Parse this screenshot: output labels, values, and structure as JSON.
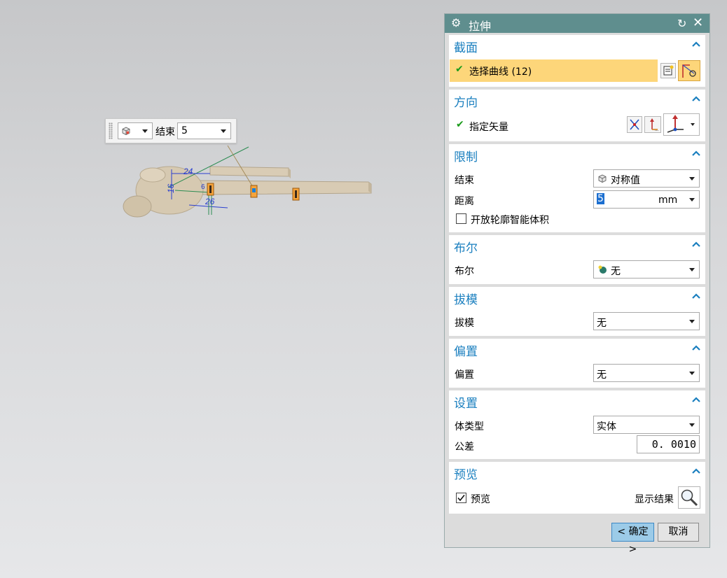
{
  "toolbar": {
    "limit_label": "结束",
    "limit_value": "5"
  },
  "sketch": {
    "dim_24": "24",
    "dim_16": "16",
    "dim_6": "6",
    "dim_26": "26"
  },
  "dialog": {
    "title": "拉伸",
    "sections": {
      "section": {
        "header": "截面",
        "select_curve": "选择曲线 (12)"
      },
      "direction": {
        "header": "方向",
        "specify_vector": "指定矢量"
      },
      "limits": {
        "header": "限制",
        "end_label": "结束",
        "end_value": "对称值",
        "distance_label": "距离",
        "distance_value": "5",
        "distance_unit": "mm",
        "open_profile_label": "开放轮廓智能体积"
      },
      "boolean": {
        "header": "布尔",
        "label": "布尔",
        "value": "无"
      },
      "draft": {
        "header": "拔模",
        "label": "拔模",
        "value": "无"
      },
      "offset": {
        "header": "偏置",
        "label": "偏置",
        "value": "无"
      },
      "settings": {
        "header": "设置",
        "body_type_label": "体类型",
        "body_type_value": "实体",
        "tolerance_label": "公差",
        "tolerance_value": "0. 0010"
      },
      "preview": {
        "header": "预览",
        "preview_label": "预览",
        "show_result_label": "显示结果"
      }
    },
    "ok_label": "< 确定 >",
    "cancel_label": "取消"
  },
  "colors": {
    "title_bar": "#5f8e8e",
    "section_header": "#1a7fbf",
    "selection_highlight": "#fdd67a",
    "ok_button": "#9ccbe8",
    "part_color": "#d8cbb4"
  },
  "icons": [
    "cube-icon",
    "gear-icon",
    "reset-icon",
    "close-icon",
    "checkmark-icon",
    "chevron-up-icon",
    "curve-rule-icon",
    "sketch-section-icon",
    "reverse-direction-icon",
    "vector-dialog-icon",
    "vector-triad-icon",
    "boolean-none-icon",
    "magnifier-icon"
  ]
}
